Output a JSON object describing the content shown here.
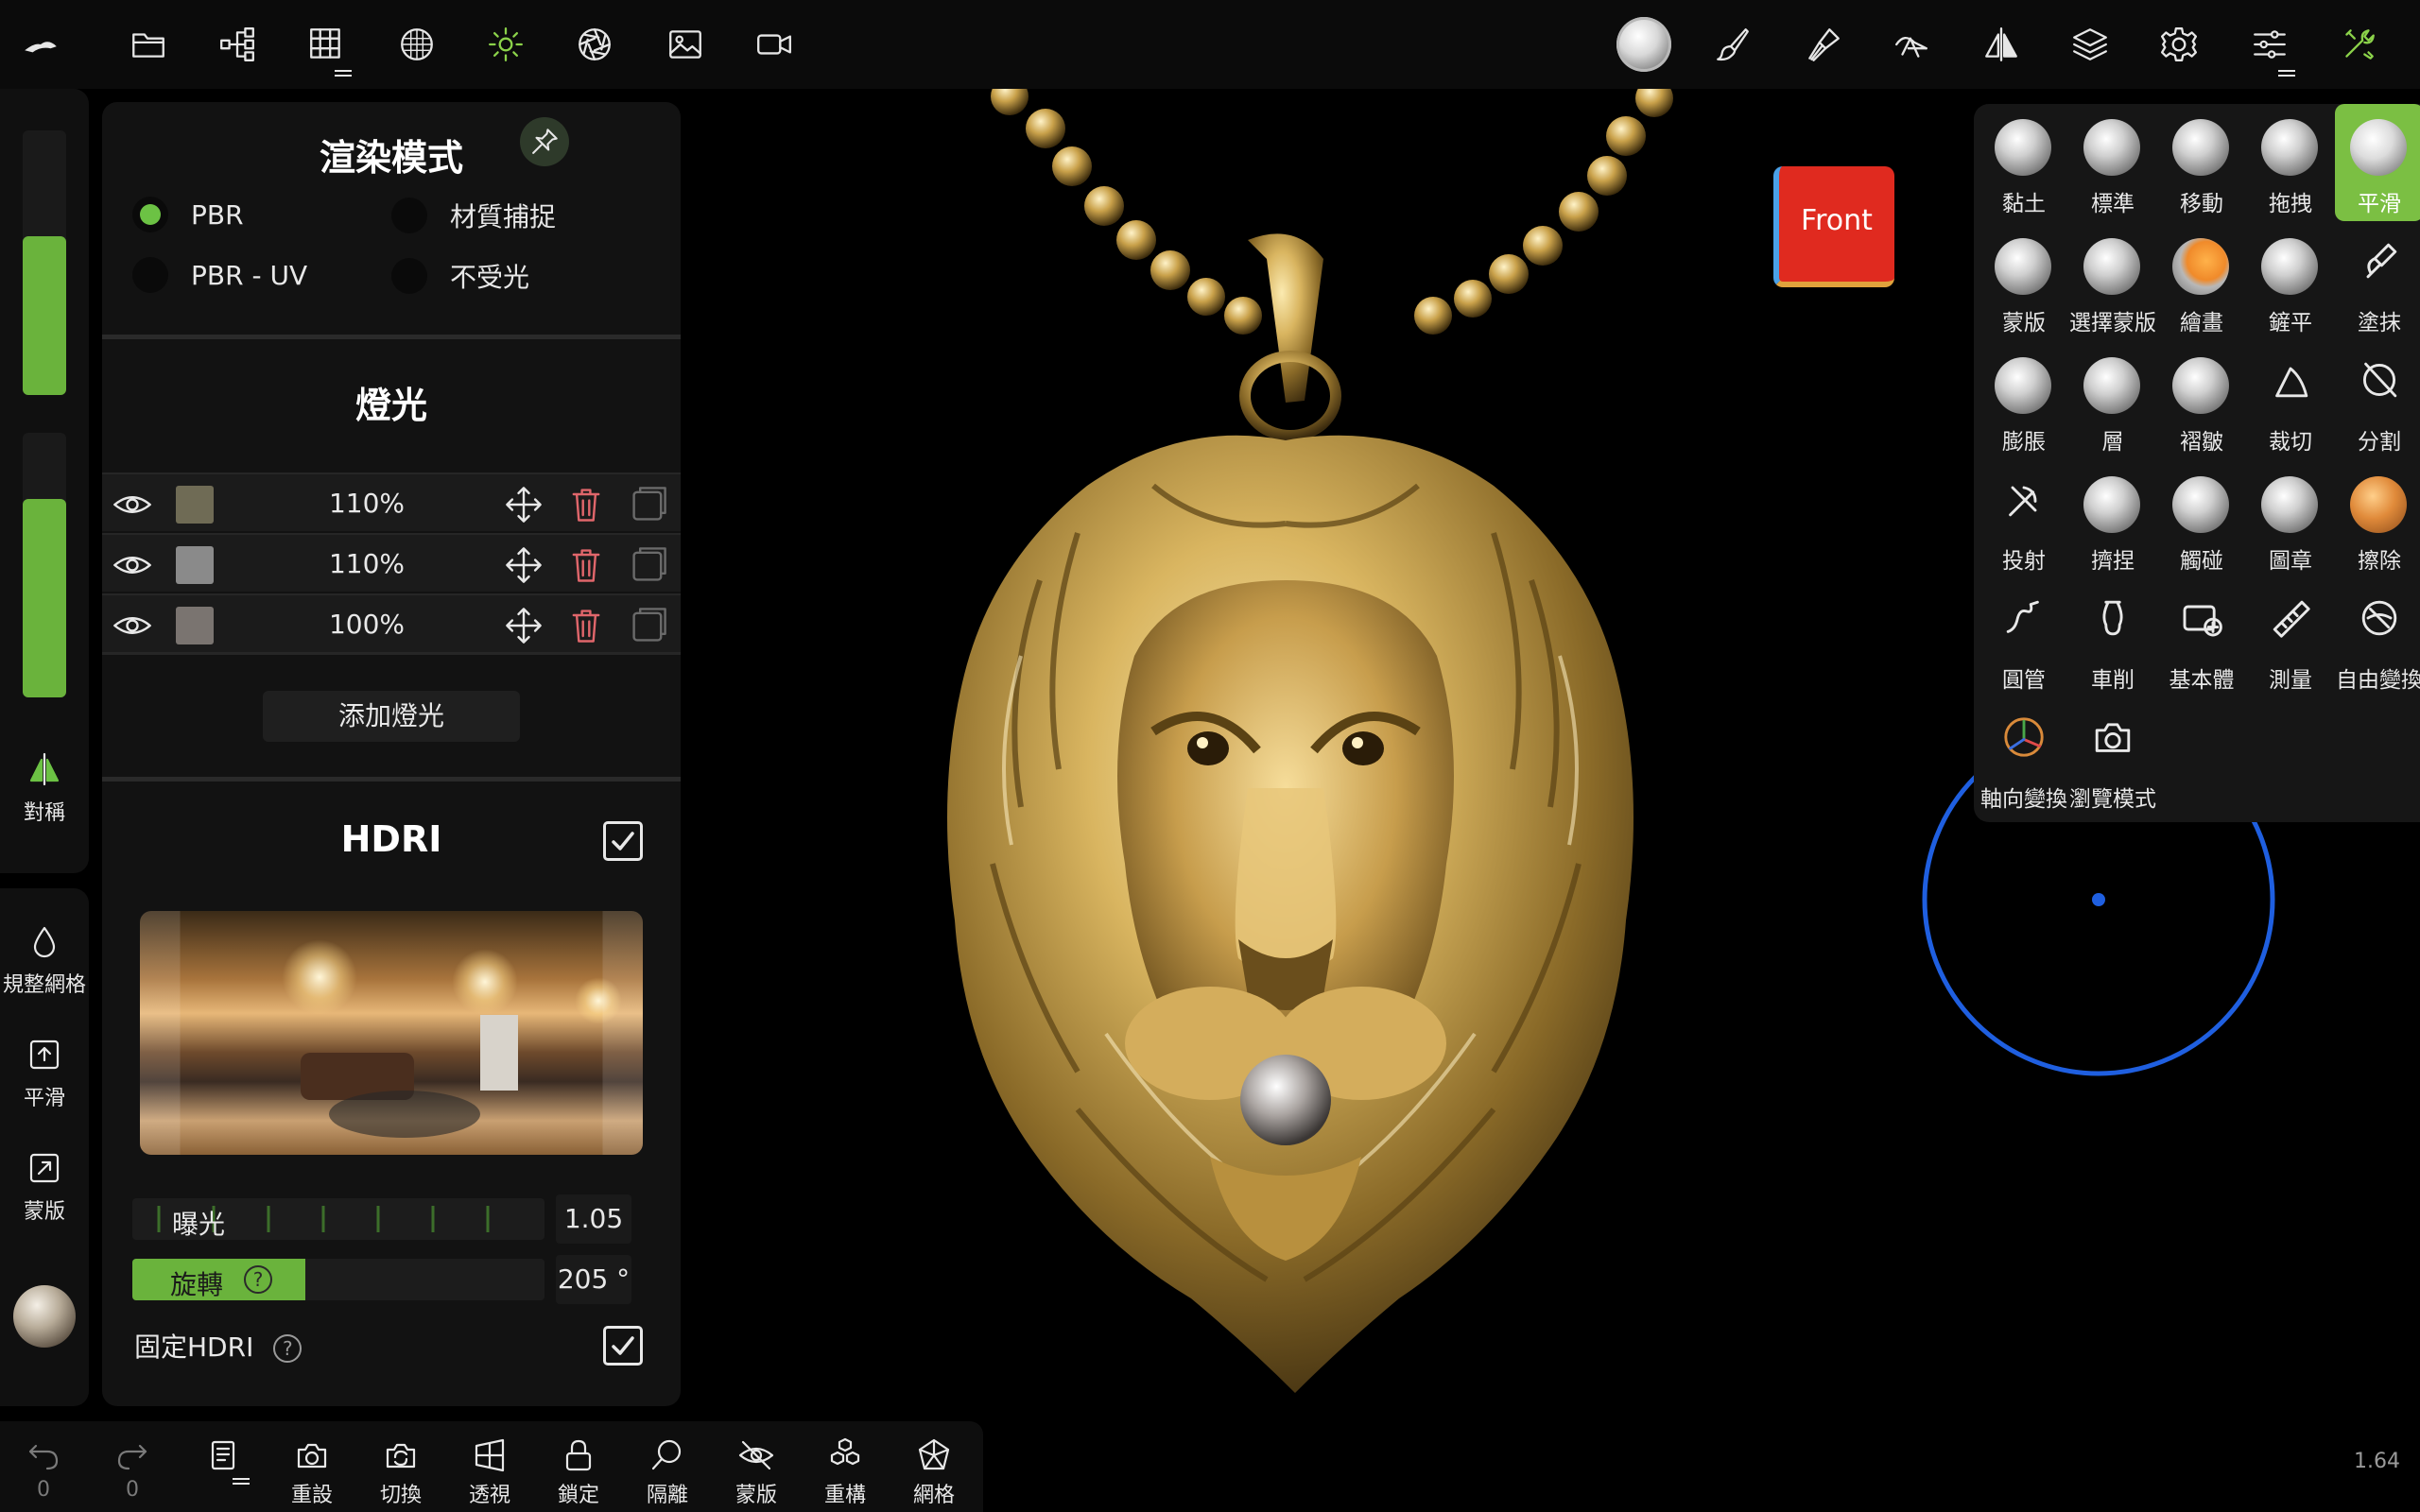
{
  "colors": {
    "accent": "#6cc244",
    "panel": "#121212",
    "gold": "#c8a14a",
    "delete": "#e0666b",
    "gizmo": "#1f5fe0"
  },
  "render_panel": {
    "title": "渲染模式",
    "modes": [
      {
        "label": "PBR",
        "selected": true
      },
      {
        "label": "材質捕捉",
        "selected": false
      },
      {
        "label": "PBR - UV",
        "selected": false
      },
      {
        "label": "不受光",
        "selected": false
      }
    ],
    "lights_title": "燈光",
    "lights": [
      {
        "intensity": "110%",
        "color": "#6f6b55"
      },
      {
        "intensity": "110%",
        "color": "#8a8a8a"
      },
      {
        "intensity": "100%",
        "color": "#7a7470"
      }
    ],
    "add_light_label": "添加燈光",
    "hdri_title": "HDRI",
    "hdri_enabled": true,
    "exposure": {
      "label": "曝光",
      "value": "1.05"
    },
    "rotation": {
      "label": "旋轉",
      "value": "205 °",
      "fraction": 0.42
    },
    "fixed_hdri": {
      "label": "固定HDRI",
      "checked": true
    }
  },
  "left_column": {
    "slider_top_fraction": 0.6,
    "slider_bottom_fraction": 0.75,
    "symmetry_label": "對稱",
    "remesh_label": "規整網格",
    "smooth_label": "平滑",
    "mask_label": "蒙版"
  },
  "bottom_bar": {
    "undo_count": "0",
    "redo_count": "0",
    "items": [
      "重設",
      "切換",
      "透視",
      "鎖定",
      "隔離",
      "蒙版",
      "重構",
      "網格"
    ]
  },
  "tools": [
    "黏土",
    "標準",
    "移動",
    "拖拽",
    "平滑",
    "蒙版",
    "選擇蒙版",
    "繪畫",
    "鏟平",
    "塗抹",
    "膨脹",
    "層",
    "褶皺",
    "裁切",
    "分割",
    "投射",
    "擠捏",
    "觸碰",
    "圖章",
    "擦除",
    "圓管",
    "車削",
    "基本體",
    "測量",
    "自由變換",
    "軸向變換",
    "瀏覽模式"
  ],
  "active_tool": "平滑",
  "viewport": {
    "view_label": "Front",
    "zoom": "1.64"
  }
}
